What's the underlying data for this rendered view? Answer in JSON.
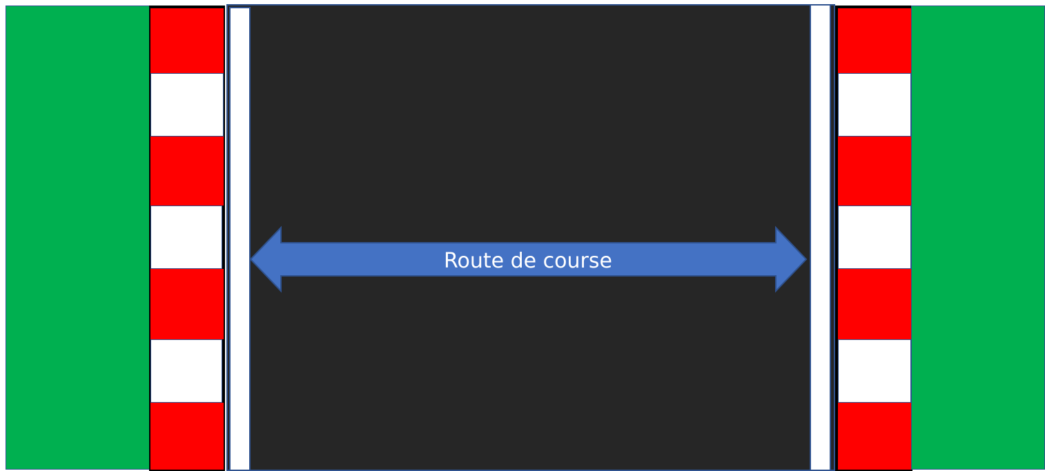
{
  "diagram": {
    "arrow_label": "Route de course"
  },
  "colors": {
    "grass": "#00b050",
    "kerb_red": "#ff0000",
    "kerb_white": "#ffffff",
    "road": "#262626",
    "arrow": "#4472c4",
    "outline": "#2f528f"
  }
}
